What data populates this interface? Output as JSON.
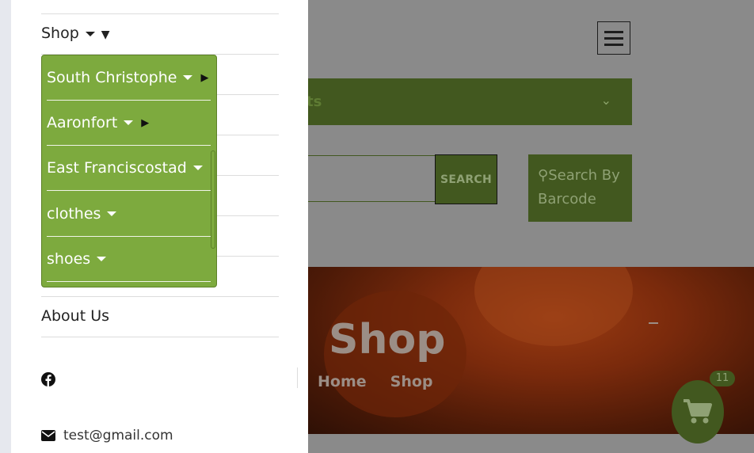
{
  "drawer": {
    "nav": [
      {
        "label": "Shop"
      },
      {
        "label": "About Us"
      }
    ],
    "dropdown": [
      {
        "label": "South Christophe",
        "has_submenu": true
      },
      {
        "label": "Aaronfort",
        "has_submenu": true
      },
      {
        "label": "East Franciscostad",
        "has_submenu": false
      },
      {
        "label": "clothes",
        "has_submenu": false
      },
      {
        "label": "shoes",
        "has_submenu": false
      }
    ],
    "social_icon": "facebook-icon",
    "email": "test@gmail.com"
  },
  "header": {
    "category_bar_text": "ts",
    "search_button": "SEARCH",
    "barcode_button": "Search By Barcode"
  },
  "hero": {
    "title": "Shop",
    "breadcrumb": [
      "Home",
      "Shop"
    ]
  },
  "cart": {
    "count": "11"
  },
  "colors": {
    "accent": "#7daa3e",
    "accent_dark": "#42581f",
    "overlay": "#8a8a8a"
  }
}
